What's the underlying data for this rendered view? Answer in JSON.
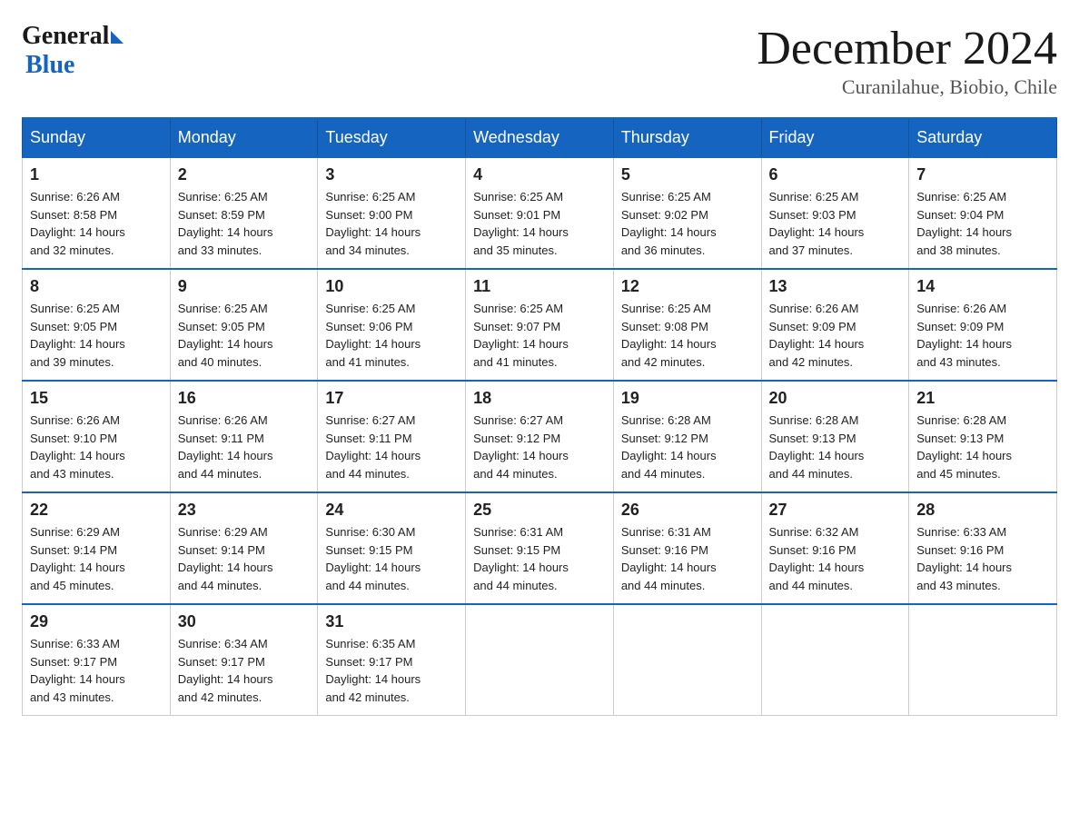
{
  "header": {
    "logo": {
      "general": "General",
      "blue": "Blue"
    },
    "title": "December 2024",
    "location": "Curanilahue, Biobio, Chile"
  },
  "weekdays": [
    "Sunday",
    "Monday",
    "Tuesday",
    "Wednesday",
    "Thursday",
    "Friday",
    "Saturday"
  ],
  "weeks": [
    [
      {
        "day": "1",
        "sunrise": "6:26 AM",
        "sunset": "8:58 PM",
        "daylight": "14 hours and 32 minutes."
      },
      {
        "day": "2",
        "sunrise": "6:25 AM",
        "sunset": "8:59 PM",
        "daylight": "14 hours and 33 minutes."
      },
      {
        "day": "3",
        "sunrise": "6:25 AM",
        "sunset": "9:00 PM",
        "daylight": "14 hours and 34 minutes."
      },
      {
        "day": "4",
        "sunrise": "6:25 AM",
        "sunset": "9:01 PM",
        "daylight": "14 hours and 35 minutes."
      },
      {
        "day": "5",
        "sunrise": "6:25 AM",
        "sunset": "9:02 PM",
        "daylight": "14 hours and 36 minutes."
      },
      {
        "day": "6",
        "sunrise": "6:25 AM",
        "sunset": "9:03 PM",
        "daylight": "14 hours and 37 minutes."
      },
      {
        "day": "7",
        "sunrise": "6:25 AM",
        "sunset": "9:04 PM",
        "daylight": "14 hours and 38 minutes."
      }
    ],
    [
      {
        "day": "8",
        "sunrise": "6:25 AM",
        "sunset": "9:05 PM",
        "daylight": "14 hours and 39 minutes."
      },
      {
        "day": "9",
        "sunrise": "6:25 AM",
        "sunset": "9:05 PM",
        "daylight": "14 hours and 40 minutes."
      },
      {
        "day": "10",
        "sunrise": "6:25 AM",
        "sunset": "9:06 PM",
        "daylight": "14 hours and 41 minutes."
      },
      {
        "day": "11",
        "sunrise": "6:25 AM",
        "sunset": "9:07 PM",
        "daylight": "14 hours and 41 minutes."
      },
      {
        "day": "12",
        "sunrise": "6:25 AM",
        "sunset": "9:08 PM",
        "daylight": "14 hours and 42 minutes."
      },
      {
        "day": "13",
        "sunrise": "6:26 AM",
        "sunset": "9:09 PM",
        "daylight": "14 hours and 42 minutes."
      },
      {
        "day": "14",
        "sunrise": "6:26 AM",
        "sunset": "9:09 PM",
        "daylight": "14 hours and 43 minutes."
      }
    ],
    [
      {
        "day": "15",
        "sunrise": "6:26 AM",
        "sunset": "9:10 PM",
        "daylight": "14 hours and 43 minutes."
      },
      {
        "day": "16",
        "sunrise": "6:26 AM",
        "sunset": "9:11 PM",
        "daylight": "14 hours and 44 minutes."
      },
      {
        "day": "17",
        "sunrise": "6:27 AM",
        "sunset": "9:11 PM",
        "daylight": "14 hours and 44 minutes."
      },
      {
        "day": "18",
        "sunrise": "6:27 AM",
        "sunset": "9:12 PM",
        "daylight": "14 hours and 44 minutes."
      },
      {
        "day": "19",
        "sunrise": "6:28 AM",
        "sunset": "9:12 PM",
        "daylight": "14 hours and 44 minutes."
      },
      {
        "day": "20",
        "sunrise": "6:28 AM",
        "sunset": "9:13 PM",
        "daylight": "14 hours and 44 minutes."
      },
      {
        "day": "21",
        "sunrise": "6:28 AM",
        "sunset": "9:13 PM",
        "daylight": "14 hours and 45 minutes."
      }
    ],
    [
      {
        "day": "22",
        "sunrise": "6:29 AM",
        "sunset": "9:14 PM",
        "daylight": "14 hours and 45 minutes."
      },
      {
        "day": "23",
        "sunrise": "6:29 AM",
        "sunset": "9:14 PM",
        "daylight": "14 hours and 44 minutes."
      },
      {
        "day": "24",
        "sunrise": "6:30 AM",
        "sunset": "9:15 PM",
        "daylight": "14 hours and 44 minutes."
      },
      {
        "day": "25",
        "sunrise": "6:31 AM",
        "sunset": "9:15 PM",
        "daylight": "14 hours and 44 minutes."
      },
      {
        "day": "26",
        "sunrise": "6:31 AM",
        "sunset": "9:16 PM",
        "daylight": "14 hours and 44 minutes."
      },
      {
        "day": "27",
        "sunrise": "6:32 AM",
        "sunset": "9:16 PM",
        "daylight": "14 hours and 44 minutes."
      },
      {
        "day": "28",
        "sunrise": "6:33 AM",
        "sunset": "9:16 PM",
        "daylight": "14 hours and 43 minutes."
      }
    ],
    [
      {
        "day": "29",
        "sunrise": "6:33 AM",
        "sunset": "9:17 PM",
        "daylight": "14 hours and 43 minutes."
      },
      {
        "day": "30",
        "sunrise": "6:34 AM",
        "sunset": "9:17 PM",
        "daylight": "14 hours and 42 minutes."
      },
      {
        "day": "31",
        "sunrise": "6:35 AM",
        "sunset": "9:17 PM",
        "daylight": "14 hours and 42 minutes."
      },
      null,
      null,
      null,
      null
    ]
  ],
  "labels": {
    "sunrise": "Sunrise:",
    "sunset": "Sunset:",
    "daylight": "Daylight:"
  }
}
